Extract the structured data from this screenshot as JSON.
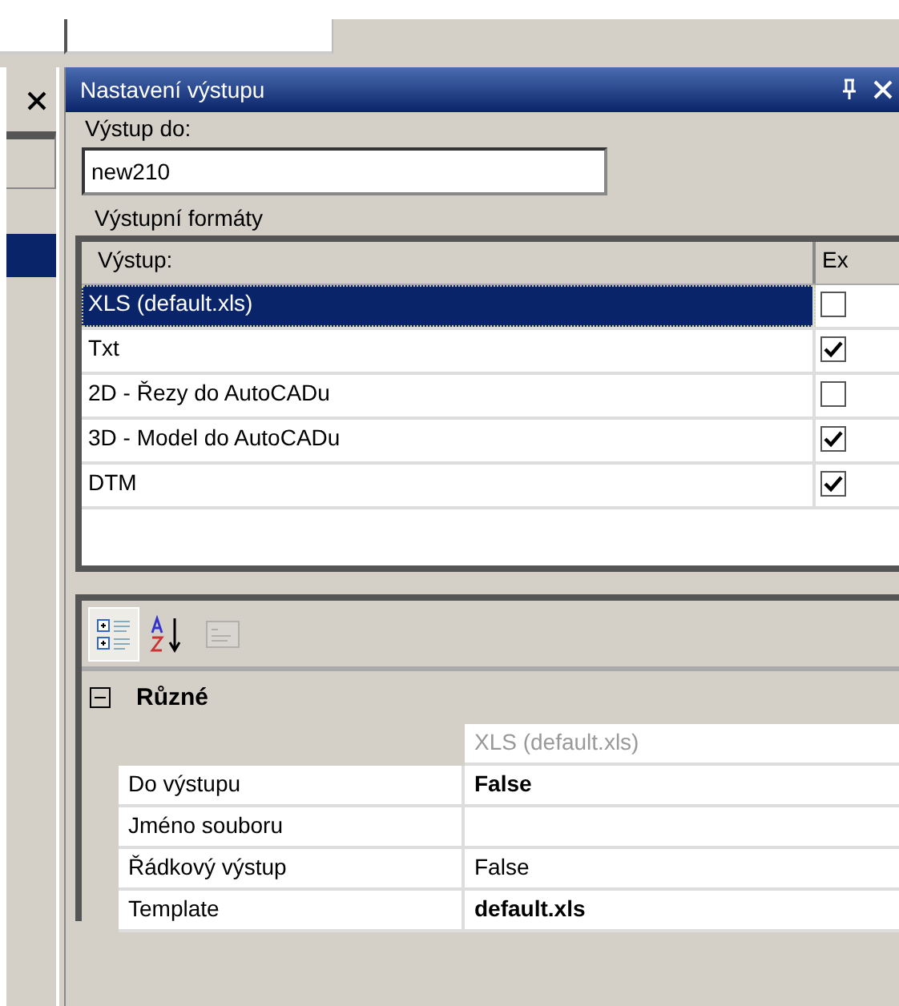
{
  "panel": {
    "title": "Nastavení výstupu",
    "output_label": "Výstup do:",
    "output_value": "new210",
    "group_label": "Výstupní formáty",
    "list": {
      "columns": [
        "Výstup:",
        "Ex"
      ],
      "rows": [
        {
          "label": "XLS (default.xls)",
          "selected": true,
          "checked": false
        },
        {
          "label": "Txt",
          "selected": false,
          "checked": true
        },
        {
          "label": "2D - Řezy do AutoCADu",
          "selected": false,
          "checked": false
        },
        {
          "label": "3D - Model do AutoCADu",
          "selected": false,
          "checked": true
        },
        {
          "label": "DTM",
          "selected": false,
          "checked": true
        }
      ]
    },
    "property_grid": {
      "toolbar": [
        {
          "kind": "categorized",
          "selected": true,
          "disabled": false
        },
        {
          "kind": "alphabetical",
          "selected": false,
          "disabled": false
        },
        {
          "kind": "pages",
          "selected": false,
          "disabled": true
        }
      ],
      "category": {
        "label": "Různé",
        "expanded": true
      },
      "object_name": "XLS (default.xls)",
      "properties": [
        {
          "name": "Do výstupu",
          "value": "False",
          "bold": true
        },
        {
          "name": "Jméno souboru"
        },
        {
          "name": "Řádkový výstup",
          "value": "False",
          "bold": false
        },
        {
          "name": "Template",
          "value": "default.xls",
          "bold": true
        }
      ]
    }
  }
}
